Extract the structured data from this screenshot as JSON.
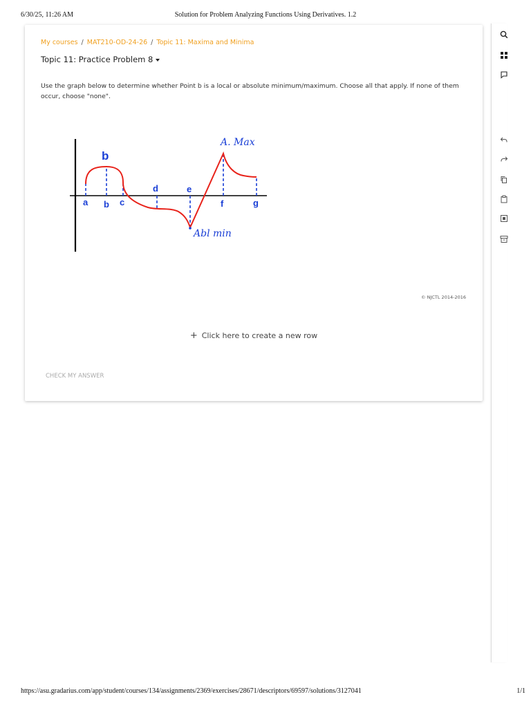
{
  "print_header": {
    "datetime": "6/30/25, 11:26 AM",
    "title": "Solution for Problem Analyzing Functions Using Derivatives. 1.2"
  },
  "breadcrumb": [
    {
      "label": "My courses"
    },
    {
      "label": "MAT210-OD-24-26"
    },
    {
      "label": "Topic 11: Maxima and Minima"
    }
  ],
  "breadcrumb_separator": "/",
  "problem": {
    "title": "Topic 11: Practice Problem 8",
    "instructions": "Use the graph below to determine whether Point b is a local or absolute minimum/maximum. Choose all that apply. If none of them occur, choose \"none\"."
  },
  "graph": {
    "point_labels": [
      "a",
      "b",
      "c",
      "d",
      "e",
      "f",
      "g"
    ],
    "top_label": "b",
    "curve_label_d": "d",
    "curve_label_e": "e",
    "annotation_max": "A. Max",
    "annotation_min": "Abl min",
    "curve_color": "#e8231b",
    "label_color": "#1a3fd6"
  },
  "copyright": "© NJCTL 2014-2016",
  "new_row_label": "Click here to create a new row",
  "check_answer_label": "CHECK MY ANSWER",
  "toolbar_icons": [
    "search-icon",
    "grid-icon",
    "comment-icon",
    "undo-icon",
    "redo-icon",
    "copy-icon",
    "clipboard-icon",
    "image-icon",
    "archive-icon"
  ],
  "print_footer": {
    "url": "https://asu.gradarius.com/app/student/courses/134/assignments/2369/exercises/28671/descriptors/69597/solutions/3127041",
    "page": "1/1"
  },
  "colors": {
    "breadcrumb": "#f0a020",
    "accent_red": "#e8231b",
    "accent_blue": "#1a3fd6"
  }
}
